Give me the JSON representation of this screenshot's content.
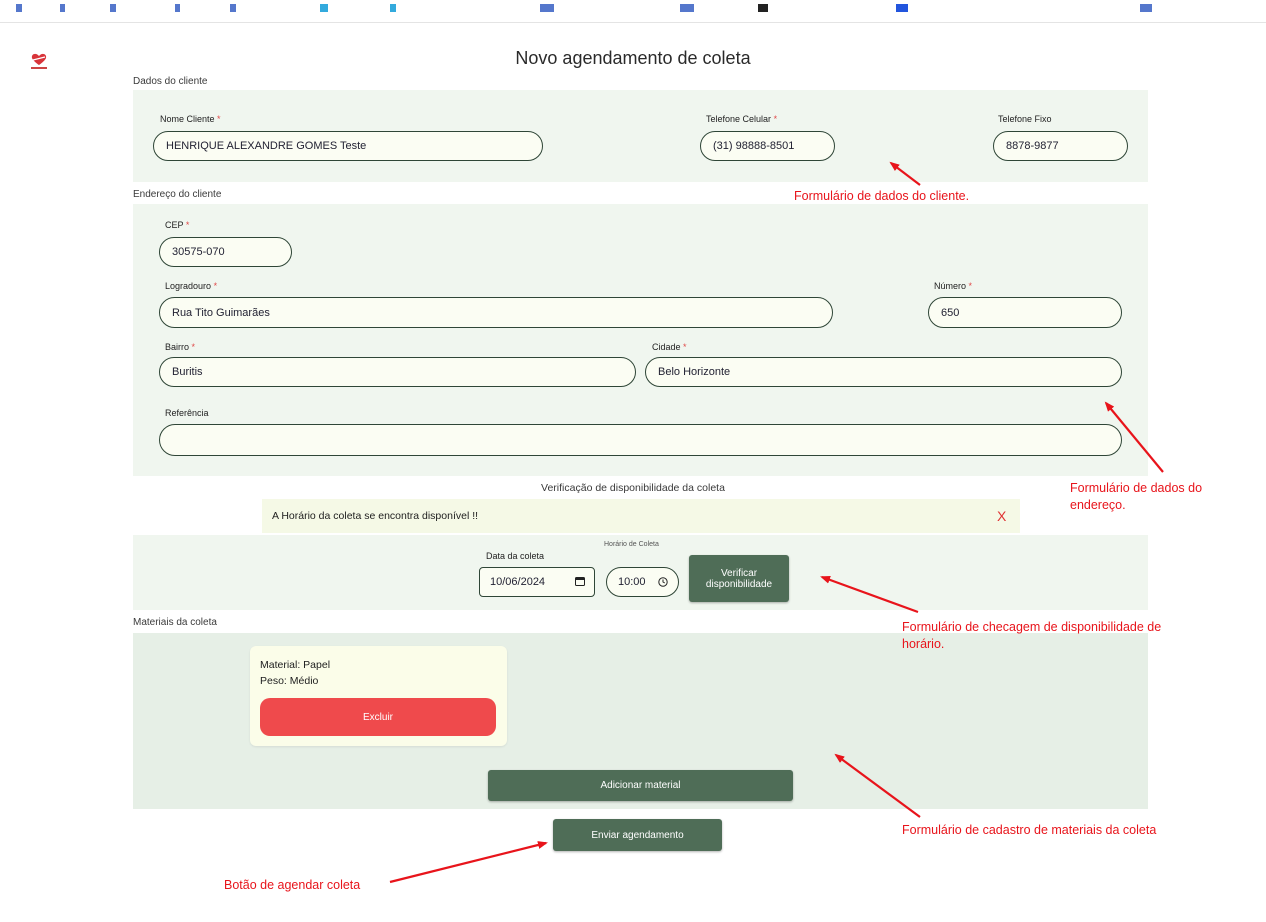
{
  "page": {
    "title": "Novo agendamento de coleta"
  },
  "cliente": {
    "section_label": "Dados do cliente",
    "nome": {
      "label": "Nome Cliente",
      "value": "HENRIQUE ALEXANDRE GOMES Teste"
    },
    "celular": {
      "label": "Telefone Celular",
      "value": "(31) 98888-8501"
    },
    "fixo": {
      "label": "Telefone Fixo",
      "value": "8878-9877"
    }
  },
  "endereco": {
    "section_label": "Endereço do cliente",
    "cep": {
      "label": "CEP",
      "value": "30575-070"
    },
    "logradouro": {
      "label": "Logradouro",
      "value": "Rua Tito Guimarães"
    },
    "numero": {
      "label": "Número",
      "value": "650"
    },
    "bairro": {
      "label": "Bairro",
      "value": "Buritis"
    },
    "cidade": {
      "label": "Cidade",
      "value": "Belo Horizonte"
    },
    "referencia": {
      "label": "Referência",
      "value": ""
    }
  },
  "required_mark": "*",
  "disponibilidade": {
    "section_label": "Verificação de disponibilidade da coleta",
    "alert_text": "A Horário da coleta se encontra disponível !!",
    "alert_close": "X",
    "data_label": "Data da coleta",
    "data_value": "10/06/2024",
    "horario_label": "Horário de Coleta",
    "horario_value": "10:00",
    "verificar_button": "Verificar disponibilidade"
  },
  "materiais": {
    "section_label": "Materiais da coleta",
    "items": [
      {
        "material": "Material: Papel",
        "peso": "Peso: Médio",
        "excluir": "Excluir"
      }
    ],
    "adicionar_button": "Adicionar material"
  },
  "enviar_button": "Enviar agendamento",
  "annotations": {
    "cliente": "Formulário de dados do cliente.",
    "endereco_line1": "Formulário de dados do",
    "endereco_line2": "endereço.",
    "checagem_line1": "Formulário de checagem de disponibilidade de",
    "checagem_line2": "horário.",
    "materiais": "Formulário de cadastro de materiais da coleta",
    "botao": "Botão de agendar coleta"
  },
  "colors": {
    "primary_button": "#4f6d57",
    "delete_button": "#ef4a4c",
    "panel": "#f0f6ef",
    "annotation": "#e8141b"
  }
}
